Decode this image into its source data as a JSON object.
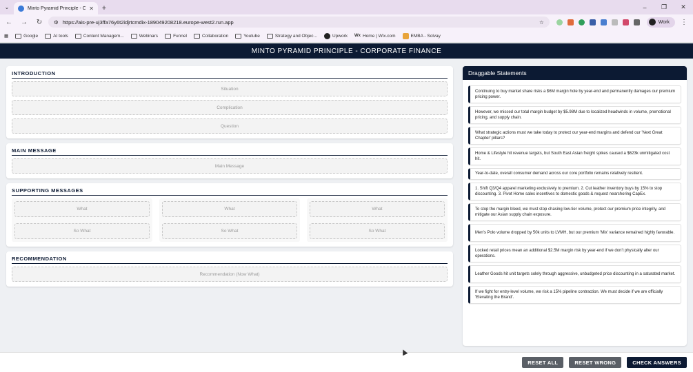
{
  "browser": {
    "tab_title": "Minto Pyramid Principle - Corp",
    "url": "https://ais-pre-uj3ffa76y6t2idjrtcmdix-189049208218.europe-west2.run.app",
    "profile_label": "Work",
    "bookmarks": [
      "Google",
      "AI tools",
      "Content Managem...",
      "Webinars",
      "Funnel",
      "Collaboration",
      "Youtube",
      "Strategy and Objec...",
      "Upwork",
      "Home | Wix.com",
      "EMBA - Solvay"
    ]
  },
  "app": {
    "title": "MINTO PYRAMID PRINCIPLE - CORPORATE FINANCE"
  },
  "introduction": {
    "title": "INTRODUCTION",
    "zones": [
      "Situation",
      "Complication",
      "Question"
    ]
  },
  "main_message": {
    "title": "MAIN MESSAGE",
    "zone": "Main Message"
  },
  "supporting": {
    "title": "SUPPORTING MESSAGES",
    "columns": [
      {
        "what": "What",
        "so_what": "So What"
      },
      {
        "what": "What",
        "so_what": "So What"
      },
      {
        "what": "What",
        "so_what": "So What"
      }
    ]
  },
  "recommendation": {
    "title": "RECOMMENDATION",
    "zone": "Recommendation (Now What)"
  },
  "statements": {
    "title": "Draggable Statements",
    "items": [
      "Continuing to buy market share risks a $6M margin hole by year-end and permanently damages our premium pricing power.",
      "However, we missed our total margin budget by $5.98M due to localized headwinds in volume, promotional pricing, and supply chain.",
      "What strategic actions must we take today to protect our year-end margins and defend our 'Next Great Chapter' pillars?",
      "Home & Lifestyle hit revenue targets, but South East Asian freight spikes caused a $623k unmitigated cost hit.",
      "Year-to-date, overall consumer demand across our core portfolio remains relatively resilient.",
      "1. Shift Q3/Q4 apparel marketing exclusively to premium. 2. Cut leather inventory buys by 15% to stop discounting. 3. Pivot Home sales incentives to domestic goods & request nearshoring CapEx.",
      "To stop the margin bleed, we must stop chasing low-tier volume, protect our premium price integrity, and mitigate our Asian supply chain exposure.",
      "Men's Polo volume dropped by 50k units to LVMH, but our premium 'Mix' variance remained highly favorable.",
      "Locked retail prices mean an additional $2.5M margin risk by year-end if we don't physically alter our operations.",
      "Leather Goods hit unit targets solely through aggressive, unbudgeted price discounting in a saturated market.",
      "If we fight for entry-level volume, we risk a 15% pipeline contraction. We must decide if we are officially 'Elevating the Brand'."
    ]
  },
  "footer": {
    "reset_all": "RESET ALL",
    "reset_wrong": "RESET WRONG",
    "check_answers": "CHECK ANSWERS"
  }
}
